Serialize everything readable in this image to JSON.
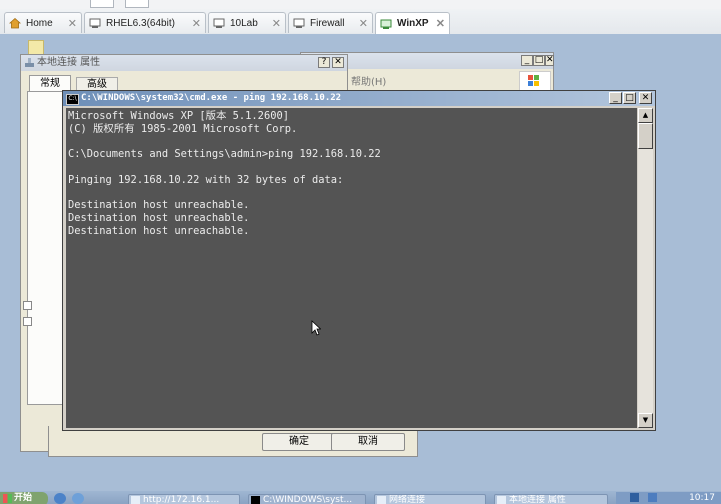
{
  "browser": {
    "tabs": [
      {
        "label": "Home",
        "icon": "home-icon"
      },
      {
        "label": "RHEL6.3(64bit)",
        "icon": "vm-icon"
      },
      {
        "label": "10Lab",
        "icon": "vm-icon"
      },
      {
        "label": "Firewall",
        "icon": "vm-icon"
      },
      {
        "label": "WinXP",
        "icon": "vm-icon",
        "active": true
      }
    ]
  },
  "properties_dialog": {
    "title": "本地连接 属性",
    "tabs": [
      "常规",
      "高级"
    ],
    "ok_label": "确定",
    "cancel_label": "取消",
    "help_btn": "?",
    "close_btn": "✕"
  },
  "network_window": {
    "menu_help": "帮助(H)"
  },
  "cmd": {
    "title": "C:\\WINDOWS\\system32\\cmd.exe - ping 192.168.10.22",
    "lines": [
      "Microsoft Windows XP [版本 5.1.2600]",
      "(C) 版权所有 1985-2001 Microsoft Corp.",
      "",
      "C:\\Documents and Settings\\admin>ping 192.168.10.22",
      "",
      "Pinging 192.168.10.22 with 32 bytes of data:",
      "",
      "Destination host unreachable.",
      "Destination host unreachable.",
      "Destination host unreachable."
    ]
  },
  "taskbar": {
    "start_label": "开始",
    "tasks": [
      {
        "label": "http://172.16.1..."
      },
      {
        "label": "C:\\WINDOWS\\syst..."
      },
      {
        "label": "网络连接"
      },
      {
        "label": "本地连接 属性"
      }
    ],
    "clock": "10:17"
  },
  "colors": {
    "desktop": "#a8bdd6",
    "console_bg": "#545454",
    "console_fg": "#ececec",
    "cmd_title_left": "#6e8fb8"
  }
}
